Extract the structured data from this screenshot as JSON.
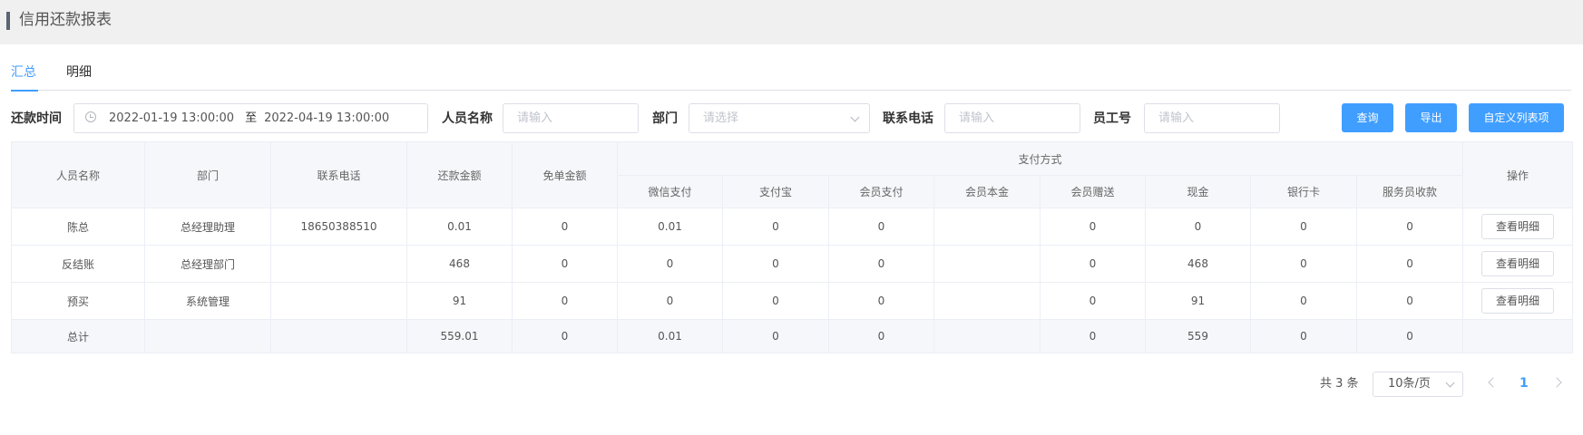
{
  "page": {
    "title": "信用还款报表"
  },
  "tabs": [
    {
      "label": "汇总",
      "active": true
    },
    {
      "label": "明细",
      "active": false
    }
  ],
  "filters": {
    "time_label": "还款时间",
    "time_start": "2022-01-19 13:00:00",
    "range_sep": "至",
    "time_end": "2022-04-19 13:00:00",
    "name_label": "人员名称",
    "name_placeholder": "请输入",
    "dept_label": "部门",
    "dept_placeholder": "请选择",
    "phone_label": "联系电话",
    "phone_placeholder": "请输入",
    "empno_label": "员工号",
    "empno_placeholder": "请输入"
  },
  "buttons": {
    "query": "查询",
    "export": "导出",
    "custom_columns": "自定义列表项"
  },
  "table": {
    "headers": {
      "name": "人员名称",
      "dept": "部门",
      "phone": "联系电话",
      "repay": "还款金额",
      "waive": "免单金额",
      "payment_group": "支付方式",
      "wechat": "微信支付",
      "alipay": "支付宝",
      "member_pay": "会员支付",
      "member_principal": "会员本金",
      "member_gift": "会员赠送",
      "cash": "现金",
      "bank_card": "银行卡",
      "waiter": "服务员收款",
      "action": "操作"
    },
    "rows": [
      {
        "name": "陈总",
        "dept": "总经理助理",
        "phone": "18650388510",
        "repay": "0.01",
        "waive": "0",
        "wechat": "0.01",
        "alipay": "0",
        "member_pay": "0",
        "member_principal": "",
        "member_gift": "0",
        "cash": "0",
        "bank_card": "0",
        "waiter": "0",
        "action": "查看明细"
      },
      {
        "name": "反结账",
        "dept": "总经理部门",
        "phone": "",
        "repay": "468",
        "waive": "0",
        "wechat": "0",
        "alipay": "0",
        "member_pay": "0",
        "member_principal": "",
        "member_gift": "0",
        "cash": "468",
        "bank_card": "0",
        "waiter": "0",
        "action": "查看明细"
      },
      {
        "name": "预买",
        "dept": "系统管理",
        "phone": "",
        "repay": "91",
        "waive": "0",
        "wechat": "0",
        "alipay": "0",
        "member_pay": "0",
        "member_principal": "",
        "member_gift": "0",
        "cash": "91",
        "bank_card": "0",
        "waiter": "0",
        "action": "查看明细"
      }
    ],
    "total": {
      "name": "总计",
      "dept": "",
      "phone": "",
      "repay": "559.01",
      "waive": "0",
      "wechat": "0.01",
      "alipay": "0",
      "member_pay": "0",
      "member_principal": "",
      "member_gift": "0",
      "cash": "559",
      "bank_card": "0",
      "waiter": "0"
    }
  },
  "pagination": {
    "total_text": "共 3 条",
    "page_size": "10条/页",
    "current_page": "1"
  },
  "colors": {
    "primary": "#409eff",
    "header_bg": "#f5f7fa",
    "border": "#ebeef5"
  }
}
